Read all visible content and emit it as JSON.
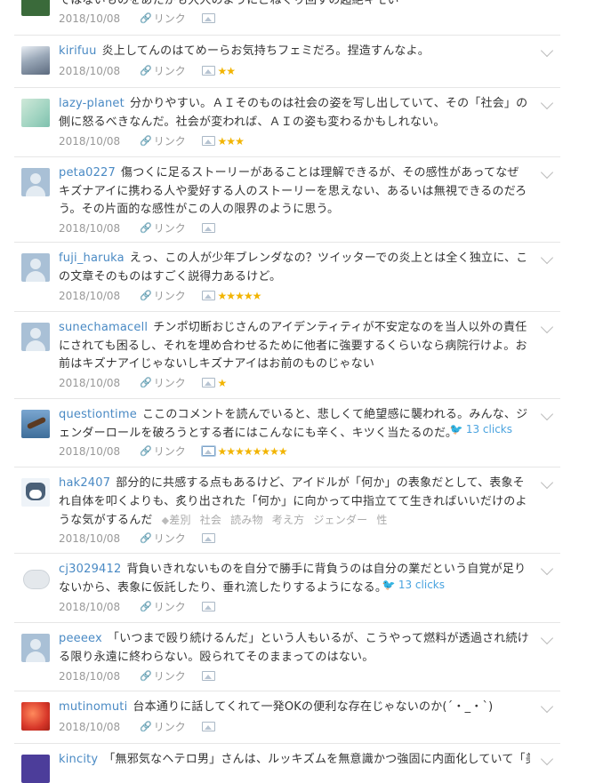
{
  "comments": [
    {
      "user": "",
      "text": "ではないものをあたかも大人のようにこねくり回すの超絶キモい",
      "date": "2018/10/08",
      "stars": ""
    },
    {
      "user": "kirifuu",
      "text": "炎上してんのはてめーらお気持ちフェミだろ。捏造すんなよ。",
      "date": "2018/10/08",
      "stars": "★★"
    },
    {
      "user": "lazy-planet",
      "text": "分かりやすい。ＡＩそのものは社会の姿を写し出していて、その「社会」の側に怒るべきなんだ。社会が変われば、ＡＩの姿も変わるかもしれない。",
      "date": "2018/10/08",
      "stars": "★★★"
    },
    {
      "user": "peta0227",
      "text": "傷つくに足るストーリーがあることは理解できるが、その感性があってなぜキズナアイに携わる人や愛好する人のストーリーを思えない、あるいは無視できるのだろう。その片面的な感性がこの人の限界のように思う。",
      "date": "2018/10/08",
      "stars": ""
    },
    {
      "user": "fuji_haruka",
      "text": "えっ、この人が少年ブレンダなの？ツイッターでの炎上とは全く独立に、この文章そのものはすごく説得力あるけど。",
      "date": "2018/10/08",
      "stars": "★★★★★"
    },
    {
      "user": "sunechamacell",
      "text": "チンポ切断おじさんのアイデンティティが不安定なのを当人以外の責任にされても困るし、それを埋め合わせるために他者に強要するくらいなら病院行けよ。お前はキズナアイじゃないしキズナアイはお前のものじゃない",
      "date": "2018/10/08",
      "stars": "★"
    },
    {
      "user": "questiontime",
      "text": "ここのコメントを読んでいると、悲しくて絶望感に襲われる。みんな、ジェンダーロールを破ろうとする者にはこんなにも辛く、キツく当たるのだ。",
      "date": "2018/10/08",
      "stars": "★★★★★★★★",
      "clicks": "13 clicks"
    },
    {
      "user": "hak2407",
      "text": "部分的に共感する点もあるけど、アイドルが「何か」の表象だとして、表象それ自体を叩くよりも、炙り出された「何か」に向かって中指立てて生きればいいだけのような気がするんだ",
      "date": "2018/10/08",
      "stars": "",
      "tags": "差別 社会 読み物 考え方 ジェンダー 性"
    },
    {
      "user": "cj3029412",
      "text": "背負いきれないものを自分で勝手に背負うのは自分の業だという自覚が足りないから、表象に仮託したり、垂れ流したりするようになる。",
      "date": "2018/10/08",
      "stars": "",
      "clicks": "13 clicks"
    },
    {
      "user": "peeeex",
      "text": "「いつまで殴り続けるんだ」という人もいるが、こうやって燃料が透過され続ける限り永遠に終わらない。殴られてそのままってのはない。",
      "date": "2018/10/08",
      "stars": ""
    },
    {
      "user": "mutinomuti",
      "text": "台本通りに話してくれて一発OKの便利な存在じゃないのか(´・_・`)",
      "date": "2018/10/08",
      "stars": ""
    },
    {
      "user": "kincity",
      "text": "「無邪気なヘテロ男」さんは、ルッキズムを無意識かつ強固に内面化していて「美",
      "date": "",
      "stars": ""
    }
  ],
  "ui": {
    "link_label": "リンク"
  },
  "colors": {
    "username": "#4a8ac4",
    "star": "#f2b400",
    "clicks": "#4aa3df"
  }
}
